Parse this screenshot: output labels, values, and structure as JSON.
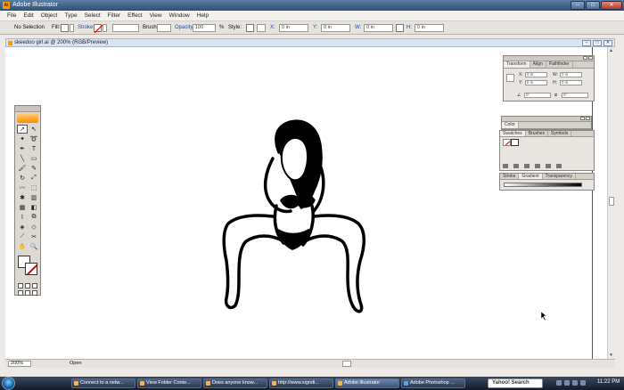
{
  "window": {
    "title": "Adobe Illustrator",
    "controls": [
      "–",
      "□",
      "✕"
    ]
  },
  "menu": [
    "File",
    "Edit",
    "Object",
    "Type",
    "Select",
    "Filter",
    "Effect",
    "View",
    "Window",
    "Help"
  ],
  "control_bar": {
    "selection": "No Selection",
    "fill_label": "Fill:",
    "stroke_label": "Stroke:",
    "brush_label": "Brush:",
    "opacity_label": "Opacity:",
    "opacity_value": "100",
    "opacity_unit": "%",
    "style_label": "Style:",
    "x_label": "X:",
    "x_value": "0 in",
    "y_label": "Y:",
    "y_value": "0 in",
    "w_label": "W:",
    "w_value": "0 in",
    "h_label": "H:",
    "h_value": "0 in"
  },
  "document": {
    "tab_title": "skeedoo girl.ai @ 200% (RGB/Preview)",
    "buttons": [
      "–",
      "□",
      "✕"
    ]
  },
  "transform_panel": {
    "tabs": [
      "Transform",
      "Align",
      "Pathfinder"
    ],
    "x_label": "X:",
    "x_value": "0 in",
    "y_label": "Y:",
    "y_value": "0 in",
    "w_label": "W:",
    "w_value": "0 in",
    "h_label": "H:",
    "h_value": "0 in",
    "angle_value": "0°",
    "shear_value": "0°"
  },
  "color_panel": {
    "tab": "Color"
  },
  "swatches_panel": {
    "tabs": [
      "Swatches",
      "Brushes",
      "Symbols"
    ]
  },
  "stroke_panel": {
    "tabs": [
      "Stroke",
      "Gradient",
      "Transparency"
    ]
  },
  "status": {
    "zoom": "200%",
    "info": "Open"
  },
  "taskbar": {
    "buttons": [
      "Connect to a netw...",
      "View Folder Conte...",
      "Does anyone know...",
      "http://www.signdi...",
      "Adobe Illustrator",
      "Adobe Photoshop ..."
    ],
    "search_label": "Yahoo! Search",
    "clock": "11:22 PM"
  }
}
